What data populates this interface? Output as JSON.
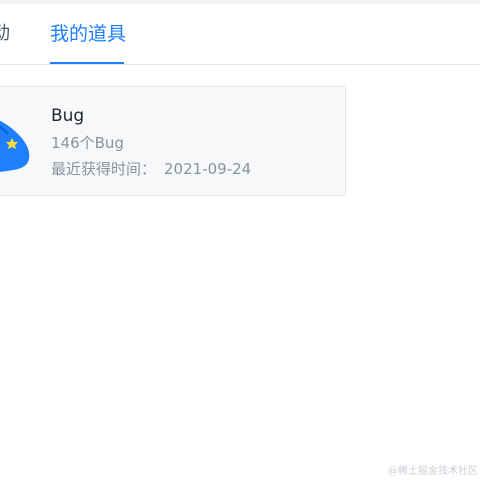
{
  "tabs": {
    "partial_label": "动",
    "active_label": "我的道具"
  },
  "item": {
    "name": "Bug",
    "count": "146个Bug",
    "date_label": "最近获得时间：",
    "date_value": "2021-09-24",
    "badge_icon": "bug-badge-icon",
    "badge_text": "</>"
  },
  "watermark": "@稀土掘金技术社区",
  "colors": {
    "accent": "#1e80ff",
    "card_bg": "#f7f8fa",
    "text_primary": "#252933",
    "text_secondary": "#8a919f"
  }
}
